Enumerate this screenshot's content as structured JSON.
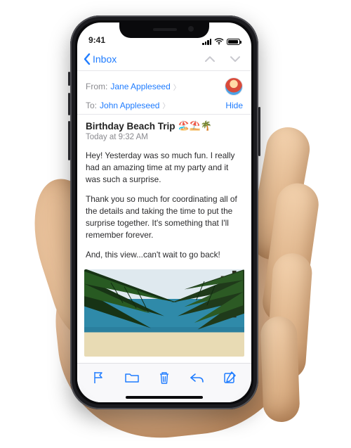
{
  "status": {
    "time": "9:41"
  },
  "nav": {
    "back_label": "Inbox"
  },
  "header": {
    "from_label": "From:",
    "from_name": "Jane Appleseed",
    "to_label": "To:",
    "to_name": "John Appleseed",
    "hide_label": "Hide"
  },
  "subject": {
    "title": "Birthday Beach Trip",
    "emoji": "🏖️⛱️🌴",
    "date": "Today at 9:32 AM"
  },
  "body": {
    "p1": "Hey! Yesterday was so much fun. I really had an amazing time at my party and it was such a surprise.",
    "p2": "Thank you so much for coordinating all of the details and taking the time to put the surprise together. It's something that I'll remember forever.",
    "p3": "And, this view...can't wait to go back!"
  },
  "toolbar": {
    "flag": "Flag",
    "move": "Move",
    "trash": "Delete",
    "reply": "Reply",
    "compose": "Compose"
  }
}
